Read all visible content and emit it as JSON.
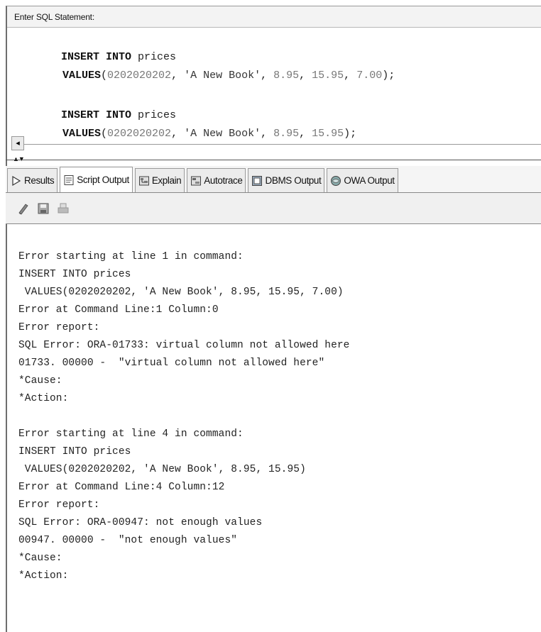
{
  "editor": {
    "label": "Enter SQL Statement:",
    "statements": [
      {
        "line1": {
          "kw": "INSERT INTO",
          "rest": " prices"
        },
        "line2": {
          "kw": "VALUES",
          "open": "(",
          "n1": "0202020202",
          "sep1": ", ",
          "s1": "'A New Book'",
          "sep2": ", ",
          "n2": "8.95",
          "sep3": ", ",
          "n3": "15.95",
          "sep4": ", ",
          "n4": "7.00",
          "close": ");"
        }
      },
      {
        "line1": {
          "kw": "INSERT INTO",
          "rest": " prices"
        },
        "line2": {
          "kw": "VALUES",
          "open": "(",
          "n1": "0202020202",
          "sep1": ", ",
          "s1": "'A New Book'",
          "sep2": ", ",
          "n2": "8.95",
          "sep3": ", ",
          "n3": "15.95",
          "close": ");"
        }
      }
    ],
    "scroll_left_glyph": "◂",
    "splitter_glyph": "▲▼"
  },
  "tabs": [
    {
      "label": "Results",
      "icon": "play-icon",
      "active": false
    },
    {
      "label": "Script Output",
      "icon": "script-output-icon",
      "active": true
    },
    {
      "label": "Explain",
      "icon": "explain-icon",
      "active": false
    },
    {
      "label": "Autotrace",
      "icon": "autotrace-icon",
      "active": false
    },
    {
      "label": "DBMS Output",
      "icon": "dbms-output-icon",
      "active": false
    },
    {
      "label": "OWA Output",
      "icon": "owa-output-icon",
      "active": false
    }
  ],
  "toolbar": {
    "icons": [
      "eraser-icon",
      "save-icon",
      "print-icon"
    ]
  },
  "output": {
    "lines": [
      "Error starting at line 1 in command:",
      "INSERT INTO prices",
      " VALUES(0202020202, 'A New Book', 8.95, 15.95, 7.00)",
      "Error at Command Line:1 Column:0",
      "Error report:",
      "SQL Error: ORA-01733: virtual column not allowed here",
      "01733. 00000 -  \"virtual column not allowed here\"",
      "*Cause:",
      "*Action:",
      "",
      "Error starting at line 4 in command:",
      "INSERT INTO prices",
      " VALUES(0202020202, 'A New Book', 8.95, 15.95)",
      "Error at Command Line:4 Column:12",
      "Error report:",
      "SQL Error: ORA-00947: not enough values",
      "00947. 00000 -  \"not enough values\"",
      "*Cause:",
      "*Action:"
    ]
  }
}
